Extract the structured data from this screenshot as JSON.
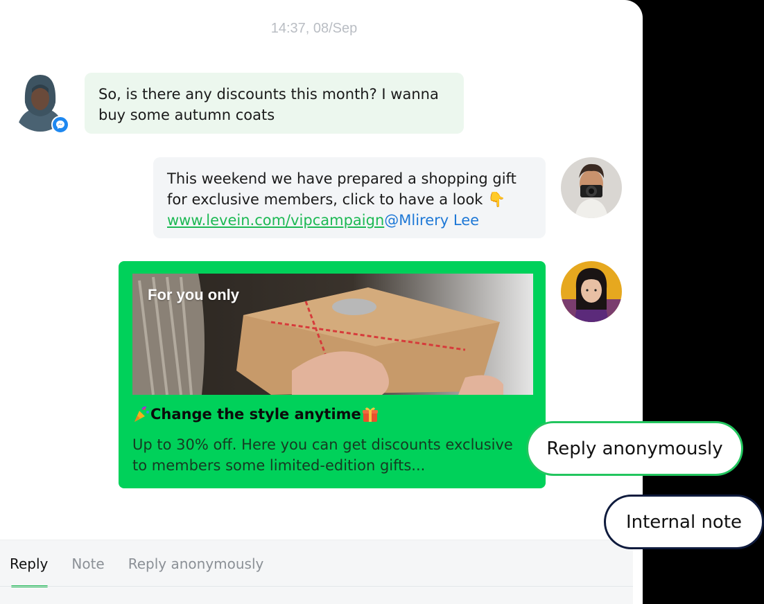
{
  "timestamp": "14:37, 08/Sep",
  "messages": {
    "incoming": {
      "text": "So, is there any discounts this month? I wanna buy some autumn coats",
      "channel_icon": "messenger-icon"
    },
    "outgoing": {
      "text": "This weekend we have prepared a shopping gift for exclusive members, click to have a look",
      "emoji": "👇",
      "link": "www.levein.com/vipcampaign",
      "mention": "@Mlirery Lee"
    }
  },
  "card": {
    "tag": "For you only",
    "title": "Change the style anytime",
    "title_prefix_icon": "party-popper-icon",
    "title_suffix_icon": "gift-icon",
    "description": "Up to 30% off. Here you can get discounts exclusive to members some limited-edition gifts...",
    "background_color": "#00d15a"
  },
  "actions": {
    "reply_anonymously": "Reply anonymously",
    "internal_note": "Internal note"
  },
  "composer": {
    "tabs": [
      {
        "label": "Reply",
        "active": true
      },
      {
        "label": "Note",
        "active": false
      },
      {
        "label": "Reply anonymously",
        "active": false
      }
    ]
  },
  "colors": {
    "accent": "#1db954",
    "incoming_bubble": "#ecf7ee",
    "outgoing_bubble": "#f3f5f7",
    "mention": "#1e78d6"
  }
}
